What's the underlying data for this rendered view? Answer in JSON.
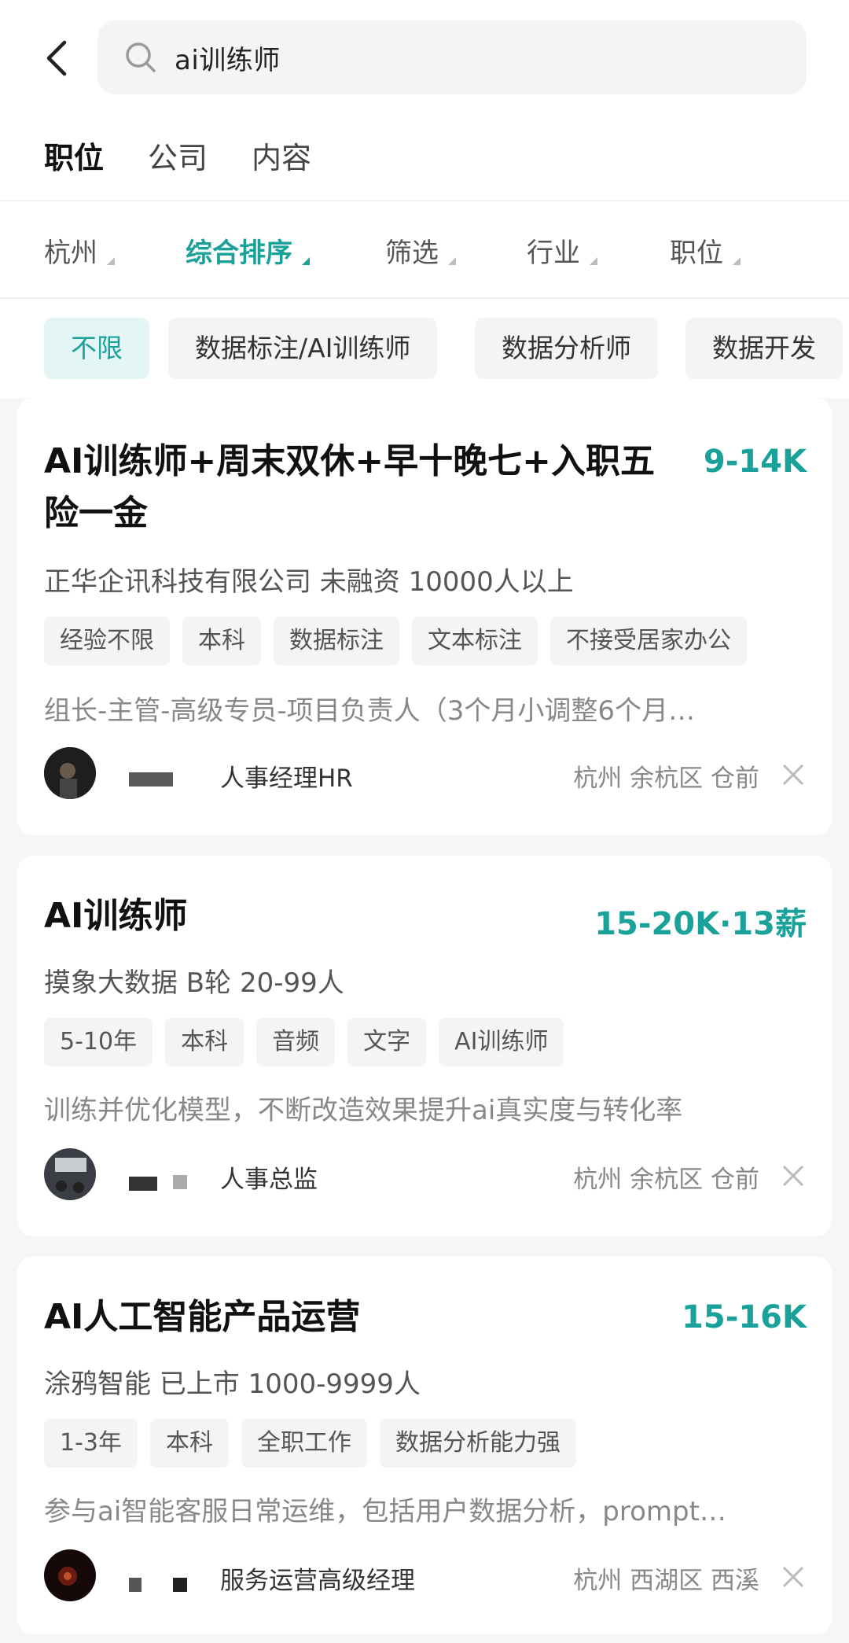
{
  "search": {
    "query": "ai训练师"
  },
  "tabs": [
    {
      "label": "职位"
    },
    {
      "label": "公司"
    },
    {
      "label": "内容"
    }
  ],
  "filters": [
    {
      "label": "杭州"
    },
    {
      "label": "综合排序"
    },
    {
      "label": "筛选"
    },
    {
      "label": "行业"
    },
    {
      "label": "职位"
    }
  ],
  "categories": [
    {
      "label": "不限"
    },
    {
      "label": "数据标注/AI训练师"
    },
    {
      "label": "数据分析师"
    },
    {
      "label": "数据开发"
    }
  ],
  "jobs": [
    {
      "title": "AI训练师+周末双休+早十晚七+入职五险一金",
      "salary": "9-14K",
      "company": "正华企讯科技有限公司 未融资 10000人以上",
      "tags": [
        "经验不限",
        "本科",
        "数据标注",
        "文本标注",
        "不接受居家办公"
      ],
      "desc": "组长-主管-高级专员-项目负责人（3个月小调整6个月…",
      "recruiter_title": "人事经理HR",
      "location": "杭州 余杭区 仓前"
    },
    {
      "title": "AI训练师",
      "salary": "15-20K·13薪",
      "company": "摸象大数据 B轮 20-99人",
      "tags": [
        "5-10年",
        "本科",
        "音频",
        "文字",
        "AI训练师"
      ],
      "desc": "训练并优化模型，不断改造效果提升ai真实度与转化率",
      "recruiter_title": "人事总监",
      "location": "杭州 余杭区 仓前"
    },
    {
      "title": "AI人工智能产品运营",
      "salary": "15-16K",
      "company": "涂鸦智能 已上市 1000-9999人",
      "tags": [
        "1-3年",
        "本科",
        "全职工作",
        "数据分析能力强"
      ],
      "desc": "参与ai智能客服日常运维，包括用户数据分析，prompt…",
      "recruiter_title": "服务运营高级经理",
      "location": "杭州 西湖区 西溪"
    }
  ],
  "colors": {
    "accent": "#1aa19a",
    "chip_active_bg": "#e3f5f4"
  }
}
